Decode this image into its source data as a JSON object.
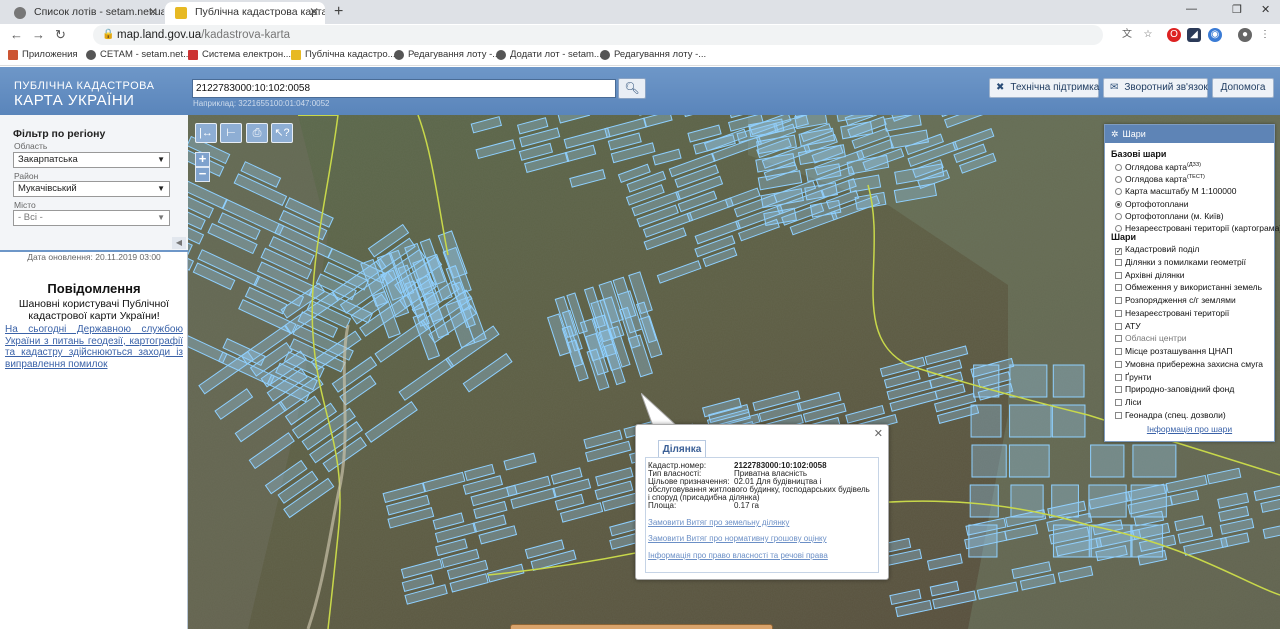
{
  "browser": {
    "tabs": [
      {
        "title": "Список лотів - setam.net.ua",
        "favicon_color": "#777777"
      },
      {
        "title": "Публічна кадастрова карта Укр",
        "favicon_color": "#e7b923"
      }
    ],
    "address": {
      "host": "map.land.gov.ua",
      "path": "/kadastrova-karta"
    },
    "bookmarks": [
      "Приложения",
      "СЕТАМ - setam.net...",
      "Система електрон...",
      "Публічна кадастро...",
      "Редагування лоту -...",
      "Додати лот - setam...",
      "Редагування лоту -..."
    ]
  },
  "header": {
    "logo_line1": "ПУБЛІЧНА КАДАСТРОВА",
    "logo_line2": "КАРТА УКРАЇНИ",
    "search_value": "2122783000:10:102:0058",
    "search_example": "Наприклад: 3221655100:01:047:0052",
    "buttons": {
      "support": "Технічна підтримка",
      "feedback": "Зворотний зв'язок",
      "help": "Допомога"
    }
  },
  "filter": {
    "title": "Фільтр по регіону",
    "region_label": "Область",
    "region_value": "Закарпатська",
    "district_label": "Район",
    "district_value": "Мукачівський",
    "city_label": "Місто",
    "city_value": "- Всі -"
  },
  "news": {
    "updated": "Дата оновлення: 20.11.2019 03:00",
    "title": "Повідомлення",
    "body": "Шановні користувачі Публічної кадастрової карти України!",
    "link": "На сьогодні Державною службою України з питань геодезії, картографії та кадастру здійснюються заходи із виправлення помилок"
  },
  "layers": {
    "title": "Шари",
    "base_title": "Базові шари",
    "base": [
      {
        "label": "Оглядова карта",
        "sup": "(ДЗЗ)",
        "selected": false
      },
      {
        "label": "Оглядова карта",
        "sup": "(ТЕСТ)",
        "selected": false
      },
      {
        "label": "Карта масштабу М 1:100000",
        "sup": "",
        "selected": false
      },
      {
        "label": "Ортофотоплани",
        "sup": "",
        "selected": true
      },
      {
        "label": "Ортофотоплани (м. Київ)",
        "sup": "",
        "selected": false
      },
      {
        "label": "Незареєстровані території (картограма)",
        "sup": "",
        "selected": false
      }
    ],
    "overlay_title": "Шари",
    "overlays": [
      {
        "label": "Кадастровий поділ",
        "checked": true,
        "disabled": false
      },
      {
        "label": "Ділянки з помилками геометрії",
        "checked": false,
        "disabled": false
      },
      {
        "label": "Архівні ділянки",
        "checked": false,
        "disabled": false
      },
      {
        "label": "Обмеження у використанні земель",
        "checked": false,
        "disabled": false
      },
      {
        "label": "Розпорядження с/г землями",
        "checked": false,
        "disabled": false
      },
      {
        "label": "Незареєстровані території",
        "checked": false,
        "disabled": false
      },
      {
        "label": "АТУ",
        "checked": false,
        "disabled": false
      },
      {
        "label": "Обласні центри",
        "checked": false,
        "disabled": true
      },
      {
        "label": "Місце розташування ЦНАП",
        "checked": false,
        "disabled": false
      },
      {
        "label": "Умовна прибережна захисна смуга",
        "checked": false,
        "disabled": false
      },
      {
        "label": "Ґрунти",
        "checked": false,
        "disabled": false
      },
      {
        "label": "Природно-заповідний фонд",
        "checked": false,
        "disabled": false
      },
      {
        "label": "Ліси",
        "checked": false,
        "disabled": false
      },
      {
        "label": "Геонадра (спец. дозволи)",
        "checked": false,
        "disabled": false
      }
    ],
    "info_link": "Інформація про шари"
  },
  "popup": {
    "tab": "Ділянка",
    "rows": [
      {
        "label": "Кадастр.номер:",
        "value": "2122783000:10:102:0058"
      },
      {
        "label": "Тип власності:",
        "value": "Приватна власність"
      },
      {
        "label": "Цільове призначення:",
        "value": "02.01 Для будівництва і обслуговування житлового будинку, господарських будівель і споруд (присадибна ділянка)"
      },
      {
        "label": "Площа:",
        "value": "0.17 га"
      }
    ],
    "links": [
      "Замовити Витяг про земельну ділянку",
      "Замовити Витяг про нормативну грошову оцінку",
      "Інформація про право власності та речові права"
    ]
  },
  "colors": {
    "header": "#6e97c8",
    "parcel": "#7ec8ff",
    "boundary": "#c8d84a"
  }
}
